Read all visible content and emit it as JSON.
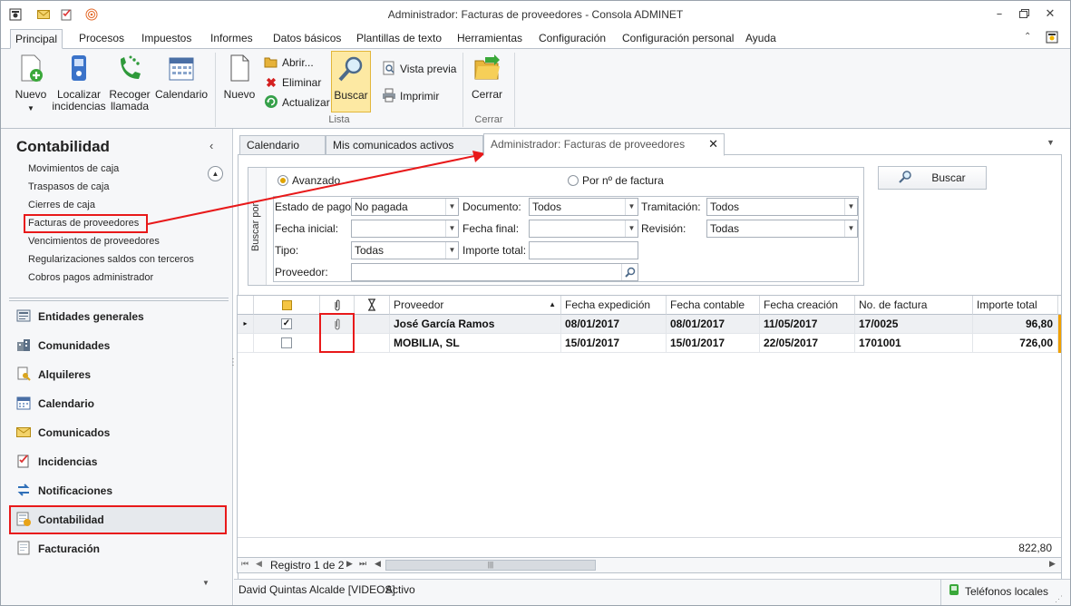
{
  "window": {
    "title": "Administrador: Facturas de proveedores - Consola ADMINET",
    "controls": [
      "minimize",
      "restore",
      "close"
    ]
  },
  "ribbon": {
    "tabs": [
      "Principal",
      "Procesos",
      "Impuestos",
      "Informes",
      "Datos básicos",
      "Plantillas de texto",
      "Herramientas",
      "Configuración",
      "Configuración personal",
      "Ayuda"
    ],
    "active_tab": "Principal",
    "buttons": {
      "nuevo_main": "Nuevo",
      "localizar": "Localizar incidencias",
      "recoger": "Recoger llamada",
      "calendario": "Calendario",
      "nuevo": "Nuevo",
      "abrir": "Abrir...",
      "eliminar": "Eliminar",
      "actualizar": "Actualizar",
      "buscar": "Buscar",
      "vista_previa": "Vista previa",
      "imprimir": "Imprimir",
      "cerrar": "Cerrar"
    },
    "groups": {
      "lista": "Lista",
      "cerrar": "Cerrar"
    }
  },
  "left_panel": {
    "title": "Contabilidad",
    "links": [
      "Movimientos de caja",
      "Traspasos de caja",
      "Cierres de caja",
      "Facturas de proveedores",
      "Vencimientos de proveedores",
      "Regularizaciones saldos con terceros",
      "Cobros pagos administrador"
    ],
    "selected_link": "Facturas de proveedores",
    "nav": [
      "Entidades generales",
      "Comunidades",
      "Alquileres",
      "Calendario",
      "Comunicados",
      "Incidencias",
      "Notificaciones",
      "Contabilidad",
      "Facturación"
    ],
    "selected_nav": "Contabilidad"
  },
  "doc_tabs": [
    "Calendario",
    "Mis comunicados activos",
    "Administrador: Facturas de proveedores"
  ],
  "active_doc_tab": "Administrador: Facturas de proveedores",
  "search": {
    "side_label": "Buscar por",
    "mode_advanced": "Avanzado",
    "mode_invoice": "Por nº de factura",
    "selected_mode": "Avanzado",
    "button": "Buscar",
    "fields": {
      "estado_pago_label": "Estado de pago:",
      "estado_pago_value": "No pagada",
      "documento_label": "Documento:",
      "documento_value": "Todos",
      "tramitacion_label": "Tramitación:",
      "tramitacion_value": "Todos",
      "fecha_inicial_label": "Fecha inicial:",
      "fecha_inicial_value": "",
      "fecha_final_label": "Fecha final:",
      "fecha_final_value": "",
      "revision_label": "Revisión:",
      "revision_value": "Todas",
      "tipo_label": "Tipo:",
      "tipo_value": "Todas",
      "importe_label": "Importe total:",
      "importe_value": "",
      "proveedor_label": "Proveedor:",
      "proveedor_value": ""
    }
  },
  "grid": {
    "columns": [
      "Proveedor",
      "Fecha expedición",
      "Fecha contable",
      "Fecha creación",
      "No. de factura",
      "Importe total"
    ],
    "sort_column": "Proveedor",
    "rows": [
      {
        "checked": true,
        "attachment": true,
        "proveedor": "José García Ramos",
        "fecha_expedicion": "08/01/2017",
        "fecha_contable": "08/01/2017",
        "fecha_creacion": "11/05/2017",
        "factura": "17/0025",
        "importe": "96,80"
      },
      {
        "checked": false,
        "attachment": false,
        "proveedor": "MOBILIA, SL",
        "fecha_expedicion": "15/01/2017",
        "fecha_contable": "15/01/2017",
        "fecha_creacion": "22/05/2017",
        "factura": "1701001",
        "importe": "726,00"
      }
    ],
    "total": "822,80",
    "record_nav": "Registro 1 de 2"
  },
  "status": {
    "user": "David Quintas Alcalde [VIDEOS]",
    "state": "Activo",
    "phones": "Teléfonos locales"
  },
  "colors": {
    "highlight": "#e8191a",
    "accent": "#f5c542",
    "ribbon_bg": "#f6f7f9"
  }
}
